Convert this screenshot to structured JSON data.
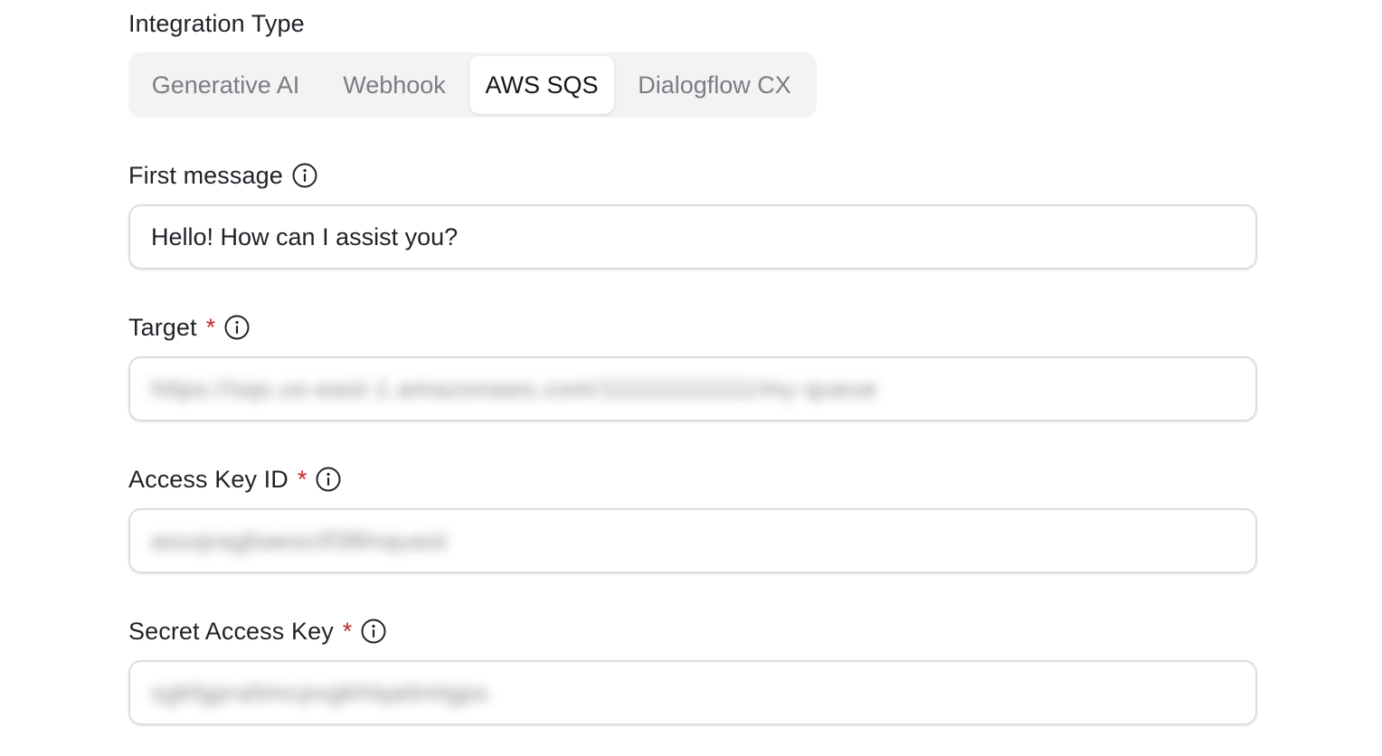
{
  "integration_type": {
    "label": "Integration Type",
    "tabs": [
      {
        "label": "Generative AI",
        "active": false
      },
      {
        "label": "Webhook",
        "active": false
      },
      {
        "label": "AWS SQS",
        "active": true
      },
      {
        "label": "Dialogflow CX",
        "active": false
      }
    ]
  },
  "first_message": {
    "label": "First message",
    "value": "Hello! How can I assist you?"
  },
  "target": {
    "label": "Target",
    "required_mark": "*",
    "value": "https://sqs.us-east-1.amazonaws.com/111111111111/my-queue"
  },
  "access_key_id": {
    "label": "Access Key ID",
    "required_mark": "*",
    "value": "aouqragbaeoctf38lnquast"
  },
  "secret_access_key": {
    "label": "Secret Access Key",
    "required_mark": "*",
    "value": "sgkfgpraltmcpvgkhlqaltmlgps"
  },
  "colors": {
    "required": "#c62828",
    "segment_bg": "#f3f3f4",
    "inactive_tab": "#7a7d84"
  }
}
